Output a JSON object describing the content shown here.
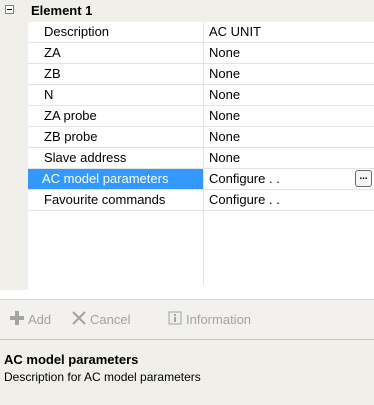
{
  "category": {
    "title": "Element 1",
    "expander_symbol": "−"
  },
  "properties": [
    {
      "name": "Description",
      "value": "AC UNIT"
    },
    {
      "name": "ZA",
      "value": "None"
    },
    {
      "name": "ZB",
      "value": "None"
    },
    {
      "name": "N",
      "value": "None"
    },
    {
      "name": "ZA probe",
      "value": "None"
    },
    {
      "name": "ZB probe",
      "value": "None"
    },
    {
      "name": "Slave address",
      "value": "None"
    },
    {
      "name": "AC model parameters",
      "value": "Configure . .",
      "selected": true
    },
    {
      "name": "Favourite commands",
      "value": "Configure . ."
    }
  ],
  "ellipsis_label": "...",
  "toolbar": {
    "add_label": "Add",
    "cancel_label": "Cancel",
    "info_label": "Information",
    "add_icon": "plus-icon",
    "cancel_icon": "x-icon",
    "info_icon": "information-icon"
  },
  "help": {
    "title": "AC model parameters",
    "description": "Description for AC model parameters"
  },
  "colors": {
    "selection": "#3399ff",
    "gutter": "#f0efe9",
    "disabled_text": "#a3a3a3"
  }
}
